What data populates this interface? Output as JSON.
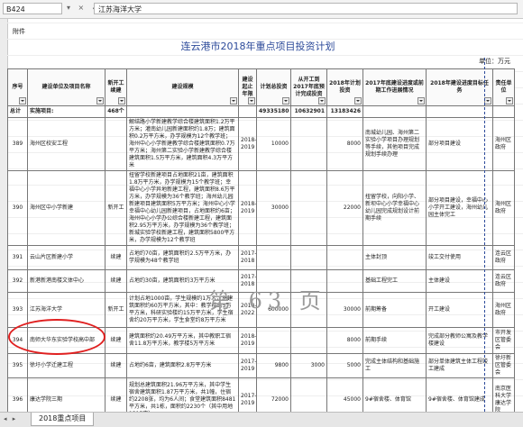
{
  "formula_bar": {
    "cell_ref": "B424",
    "fx_icons": "▾ × ✓ fx",
    "content": "江苏海洋大学"
  },
  "sheet": {
    "fujian": "附件",
    "title": "连云港市2018年重点项目投资计划",
    "unit": "单位：万元",
    "headers": [
      "序号",
      "建设单位及项目名称",
      "新开工续建",
      "建设规模",
      "建设起止年限",
      "计划总投资",
      "从开工到2017年底预计完成投资",
      "2018年计划投资",
      "2017年底建设进度或前期工作进展情况",
      "2018年建设进度目标任务",
      "责任单位"
    ],
    "total": {
      "no": "总计",
      "name": "实施项目:",
      "count": "468",
      "unit_sign": "个",
      "total_invest": "49335180",
      "done_2017": "10632901",
      "plan_2018": "13183426"
    },
    "rows": [
      {
        "no": "389",
        "name": "海州区校安工程",
        "type": "",
        "scale": "解结路小学新建教学综合楼建筑面积1.2万平方米；灌南幼儿园新建面积约1.8万；建筑面积0.2万平方米，办学规模为12个教学班；海州中心小学新建教学综合楼建筑面积0.7万平方米；海州第二实验小学新建教学综合楼建筑面积1.5万平方米，建筑面积4.3万平方米",
        "years": "2018-2019",
        "total": "10000",
        "done": "",
        "plan": "8000",
        "progress": "南城幼儿园、海州第二实验小学项目办理规划等手续，其他项目完成规划手续办理",
        "target": "部分项目建设",
        "resp": "海州区政府"
      },
      {
        "no": "390",
        "name": "海州区中小学新建",
        "type": "新开工",
        "scale": "扭留学校新建项目占地面积21亩，建筑面积1.8万平方米，办学规模为15个教学班；幸福中心小学异地新建工程，建筑面积8.6万平方米，办学规模为36个教学班；海州幼儿园新建项目建筑面积5万平方米；海州中心小学幸福中心幼儿园新建项目，占地面积约6亩；海州中心小学办公综合楼新建工程，建筑面积2.95万平方米，办学规模为36个教学班；新城实验学校新建工程，建筑面积5800平方米，办学规模为12个教学班",
        "years": "2018-2019",
        "total": "30000",
        "done": "",
        "plan": "22000",
        "progress": "扭留学校，向阳小学、新坝中心小学幸福中心幼儿园完成规划设计前期手续",
        "target": "部分项目建设，幸福中心小学开工建设，海州幼儿园主体完工",
        "resp": "海州区政府"
      },
      {
        "no": "391",
        "name": "云山片区新建小学",
        "type": "续建",
        "scale": "占地约70亩，建筑面积约2.5万平方米，办学规模为48个教学班",
        "years": "2017-2018",
        "total": "",
        "done": "",
        "plan": "",
        "progress": "主体封顶",
        "target": "竣工交付使用",
        "resp": "连云区政府"
      },
      {
        "no": "392",
        "name": "新港新港南楼文体中心",
        "type": "续建",
        "scale": "占地约30亩，建筑面积约3万平方米",
        "years": "2017-2018",
        "total": "",
        "done": "",
        "plan": "",
        "progress": "基础工程完工",
        "target": "主体建设",
        "resp": "连云区政府"
      },
      {
        "no": "393",
        "name": "江苏海洋大学",
        "type": "新开工",
        "scale": "计划占地1000亩，学生规模约1万人，总建筑面积约60万平方米，其中：教学楼约5万平方米，科研实验楼约15万平方米，学生宿舍约20万平方米，学生食堂约8万平方米",
        "years": "2018-2022",
        "total": "600000",
        "done": "",
        "plan": "30000",
        "progress": "前期筹备",
        "target": "开工建设",
        "resp": "海州区政府"
      },
      {
        "no": "394",
        "name": "南师大华东实验学校高中部",
        "type": "续建",
        "scale": "建筑面积约20.49万平方米，其中教职工宿舍11.8万平方米，教学楼5万平方米",
        "years": "2018-2019",
        "total": "",
        "done": "",
        "plan": "8000",
        "progress": "前期手续",
        "target": "完成部分教师公寓及教学楼建设",
        "resp": "市开发区管委会"
      },
      {
        "no": "395",
        "name": "徐圩小学迁建工程",
        "type": "续建",
        "scale": "占地约6亩，建筑面积2.8万平方米",
        "years": "2017-2019",
        "total": "9800",
        "done": "3000",
        "plan": "5000",
        "progress": "完成主体结构和基础施工",
        "target": "部分单体建筑主体工程竣工建成",
        "resp": "徐圩新区管委会"
      },
      {
        "no": "396",
        "name": "康达学院三期",
        "type": "续建",
        "scale": "规划总建筑面积21.96万平方米，其中学生宿舍建筑面积1.87万平方米，共1幢，住宿约2208张，均为6人间；食堂建筑面积8481平方米，共1栋，面积约2230个（其中用地1315亩）",
        "years": "2017-2019",
        "total": "72000",
        "done": "",
        "plan": "45000",
        "progress": "9#宿舍楼、体育馆",
        "target": "9#宿舍楼、体育馆建成",
        "resp": "南京医科大学康达学院"
      }
    ]
  },
  "watermark": "第 63 页",
  "sheet_tab": "2018重点项目"
}
